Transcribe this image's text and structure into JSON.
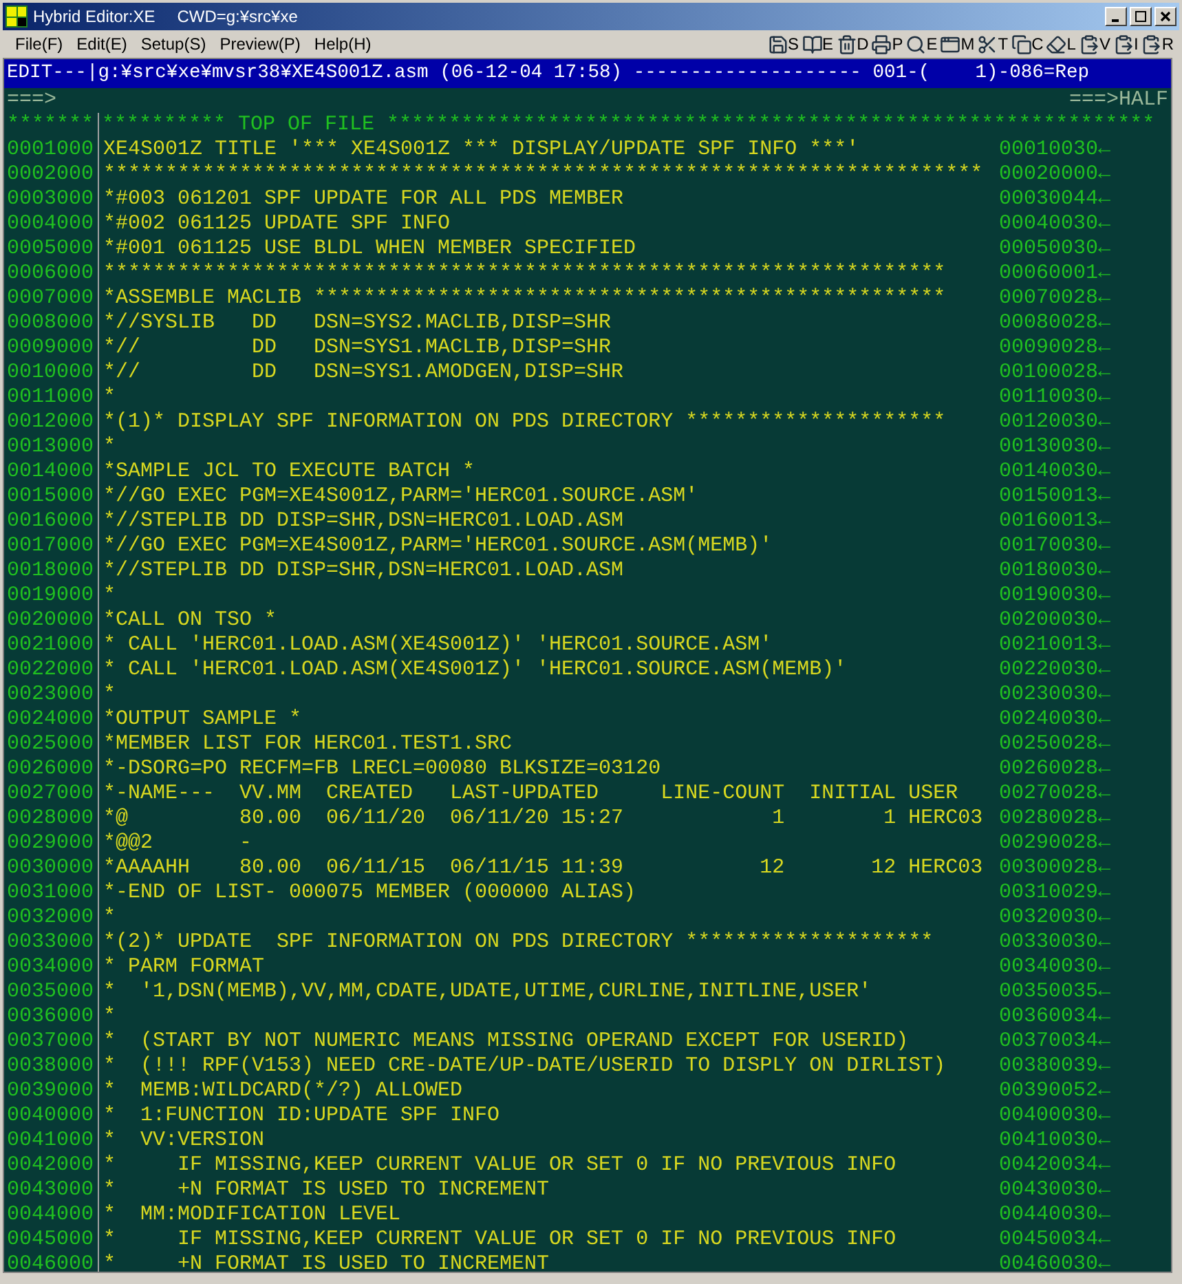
{
  "window": {
    "title": "Hybrid Editor:XE",
    "cwd": "CWD=g:¥src¥xe"
  },
  "menu": [
    "File(F)",
    "Edit(E)",
    "Setup(S)",
    "Preview(P)",
    "Help(H)"
  ],
  "toolbar": [
    {
      "kind": "save",
      "label": "S"
    },
    {
      "kind": "book",
      "label": "E"
    },
    {
      "kind": "delete",
      "label": "D"
    },
    {
      "kind": "print",
      "label": "P"
    },
    {
      "kind": "search",
      "label": "E"
    },
    {
      "kind": "window",
      "label": "M"
    },
    {
      "kind": "cut",
      "label": "T"
    },
    {
      "kind": "copy",
      "label": "C"
    },
    {
      "kind": "erase",
      "label": "L"
    },
    {
      "kind": "paste",
      "label": "V"
    },
    {
      "kind": "paste",
      "label": "I"
    },
    {
      "kind": "paste",
      "label": "R"
    }
  ],
  "header": "EDIT---|g:¥src¥xe¥mvsr38¥XE4S001Z.asm (06-12-04 17:58) -------------------- 001-(    1)-086=Rep",
  "command": {
    "prompt": "===>",
    "scroll": "===>HALF"
  },
  "top_of_file": {
    "num": "*******",
    "text": "********** TOP OF FILE **************************************************************"
  },
  "lines": [
    {
      "num": "0001000",
      "code": "XE4S001Z TITLE '*** XE4S001Z *** DISPLAY/UPDATE SPF INFO ***'",
      "seq": "00010030←"
    },
    {
      "num": "0002000",
      "code": "***********************************************************************",
      "seq": "00020000←"
    },
    {
      "num": "0003000",
      "code": "*#003 061201 SPF UPDATE FOR ALL PDS MEMBER",
      "seq": "00030044←"
    },
    {
      "num": "0004000",
      "code": "*#002 061125 UPDATE SPF INFO",
      "seq": "00040030←"
    },
    {
      "num": "0005000",
      "code": "*#001 061125 USE BLDL WHEN MEMBER SPECIFIED",
      "seq": "00050030←"
    },
    {
      "num": "0006000",
      "code": "********************************************************************",
      "seq": "00060001←"
    },
    {
      "num": "0007000",
      "code": "*ASSEMBLE MACLIB ***************************************************",
      "seq": "00070028←"
    },
    {
      "num": "0008000",
      "code": "*//SYSLIB   DD   DSN=SYS2.MACLIB,DISP=SHR",
      "seq": "00080028←"
    },
    {
      "num": "0009000",
      "code": "*//         DD   DSN=SYS1.MACLIB,DISP=SHR",
      "seq": "00090028←"
    },
    {
      "num": "0010000",
      "code": "*//         DD   DSN=SYS1.AMODGEN,DISP=SHR",
      "seq": "00100028←"
    },
    {
      "num": "0011000",
      "code": "*",
      "seq": "00110030←"
    },
    {
      "num": "0012000",
      "code": "*(1)* DISPLAY SPF INFORMATION ON PDS DIRECTORY *********************",
      "seq": "00120030←"
    },
    {
      "num": "0013000",
      "code": "*",
      "seq": "00130030←"
    },
    {
      "num": "0014000",
      "code": "*SAMPLE JCL TO EXECUTE BATCH *",
      "seq": "00140030←"
    },
    {
      "num": "0015000",
      "code": "*//GO EXEC PGM=XE4S001Z,PARM='HERC01.SOURCE.ASM'",
      "seq": "00150013←"
    },
    {
      "num": "0016000",
      "code": "*//STEPLIB DD DISP=SHR,DSN=HERC01.LOAD.ASM",
      "seq": "00160013←"
    },
    {
      "num": "0017000",
      "code": "*//GO EXEC PGM=XE4S001Z,PARM='HERC01.SOURCE.ASM(MEMB)'",
      "seq": "00170030←"
    },
    {
      "num": "0018000",
      "code": "*//STEPLIB DD DISP=SHR,DSN=HERC01.LOAD.ASM",
      "seq": "00180030←"
    },
    {
      "num": "0019000",
      "code": "*",
      "seq": "00190030←"
    },
    {
      "num": "0020000",
      "code": "*CALL ON TSO *",
      "seq": "00200030←"
    },
    {
      "num": "0021000",
      "code": "* CALL 'HERC01.LOAD.ASM(XE4S001Z)' 'HERC01.SOURCE.ASM'",
      "seq": "00210013←"
    },
    {
      "num": "0022000",
      "code": "* CALL 'HERC01.LOAD.ASM(XE4S001Z)' 'HERC01.SOURCE.ASM(MEMB)'",
      "seq": "00220030←"
    },
    {
      "num": "0023000",
      "code": "*",
      "seq": "00230030←"
    },
    {
      "num": "0024000",
      "code": "*OUTPUT SAMPLE *",
      "seq": "00240030←"
    },
    {
      "num": "0025000",
      "code": "*MEMBER LIST FOR HERC01.TEST1.SRC",
      "seq": "00250028←"
    },
    {
      "num": "0026000",
      "code": "*-DSORG=PO RECFM=FB LRECL=00080 BLKSIZE=03120",
      "seq": "00260028←"
    },
    {
      "num": "0027000",
      "code": "*-NAME---  VV.MM  CREATED   LAST-UPDATED     LINE-COUNT  INITIAL USER",
      "seq": "00270028←"
    },
    {
      "num": "0028000",
      "code": "*@         80.00  06/11/20  06/11/20 15:27            1        1 HERC03",
      "seq": "00280028←"
    },
    {
      "num": "0029000",
      "code": "*@@2       -",
      "seq": "00290028←"
    },
    {
      "num": "0030000",
      "code": "*AAAAHH    80.00  06/11/15  06/11/15 11:39           12       12 HERC03",
      "seq": "00300028←"
    },
    {
      "num": "0031000",
      "code": "*-END OF LIST- 000075 MEMBER (000000 ALIAS)",
      "seq": "00310029←"
    },
    {
      "num": "0032000",
      "code": "*",
      "seq": "00320030←"
    },
    {
      "num": "0033000",
      "code": "*(2)* UPDATE  SPF INFORMATION ON PDS DIRECTORY ********************",
      "seq": "00330030←"
    },
    {
      "num": "0034000",
      "code": "* PARM FORMAT",
      "seq": "00340030←"
    },
    {
      "num": "0035000",
      "code": "*  '1,DSN(MEMB),VV,MM,CDATE,UDATE,UTIME,CURLINE,INITLINE,USER'",
      "seq": "00350035←"
    },
    {
      "num": "0036000",
      "code": "*",
      "seq": "00360034←"
    },
    {
      "num": "0037000",
      "code": "*  (START BY NOT NUMERIC MEANS MISSING OPERAND EXCEPT FOR USERID)",
      "seq": "00370034←"
    },
    {
      "num": "0038000",
      "code": "*  (!!! RPF(V153) NEED CRE-DATE/UP-DATE/USERID TO DISPLY ON DIRLIST)",
      "seq": "00380039←"
    },
    {
      "num": "0039000",
      "code": "*  MEMB:WILDCARD(*/?) ALLOWED",
      "seq": "00390052←"
    },
    {
      "num": "0040000",
      "code": "*  1:FUNCTION ID:UPDATE SPF INFO",
      "seq": "00400030←"
    },
    {
      "num": "0041000",
      "code": "*  VV:VERSION",
      "seq": "00410030←"
    },
    {
      "num": "0042000",
      "code": "*     IF MISSING,KEEP CURRENT VALUE OR SET 0 IF NO PREVIOUS INFO",
      "seq": "00420034←"
    },
    {
      "num": "0043000",
      "code": "*     +N FORMAT IS USED TO INCREMENT",
      "seq": "00430030←"
    },
    {
      "num": "0044000",
      "code": "*  MM:MODIFICATION LEVEL",
      "seq": "00440030←"
    },
    {
      "num": "0045000",
      "code": "*     IF MISSING,KEEP CURRENT VALUE OR SET 0 IF NO PREVIOUS INFO",
      "seq": "00450034←"
    },
    {
      "num": "0046000",
      "code": "*     +N FORMAT IS USED TO INCREMENT",
      "seq": "00460030←"
    }
  ]
}
